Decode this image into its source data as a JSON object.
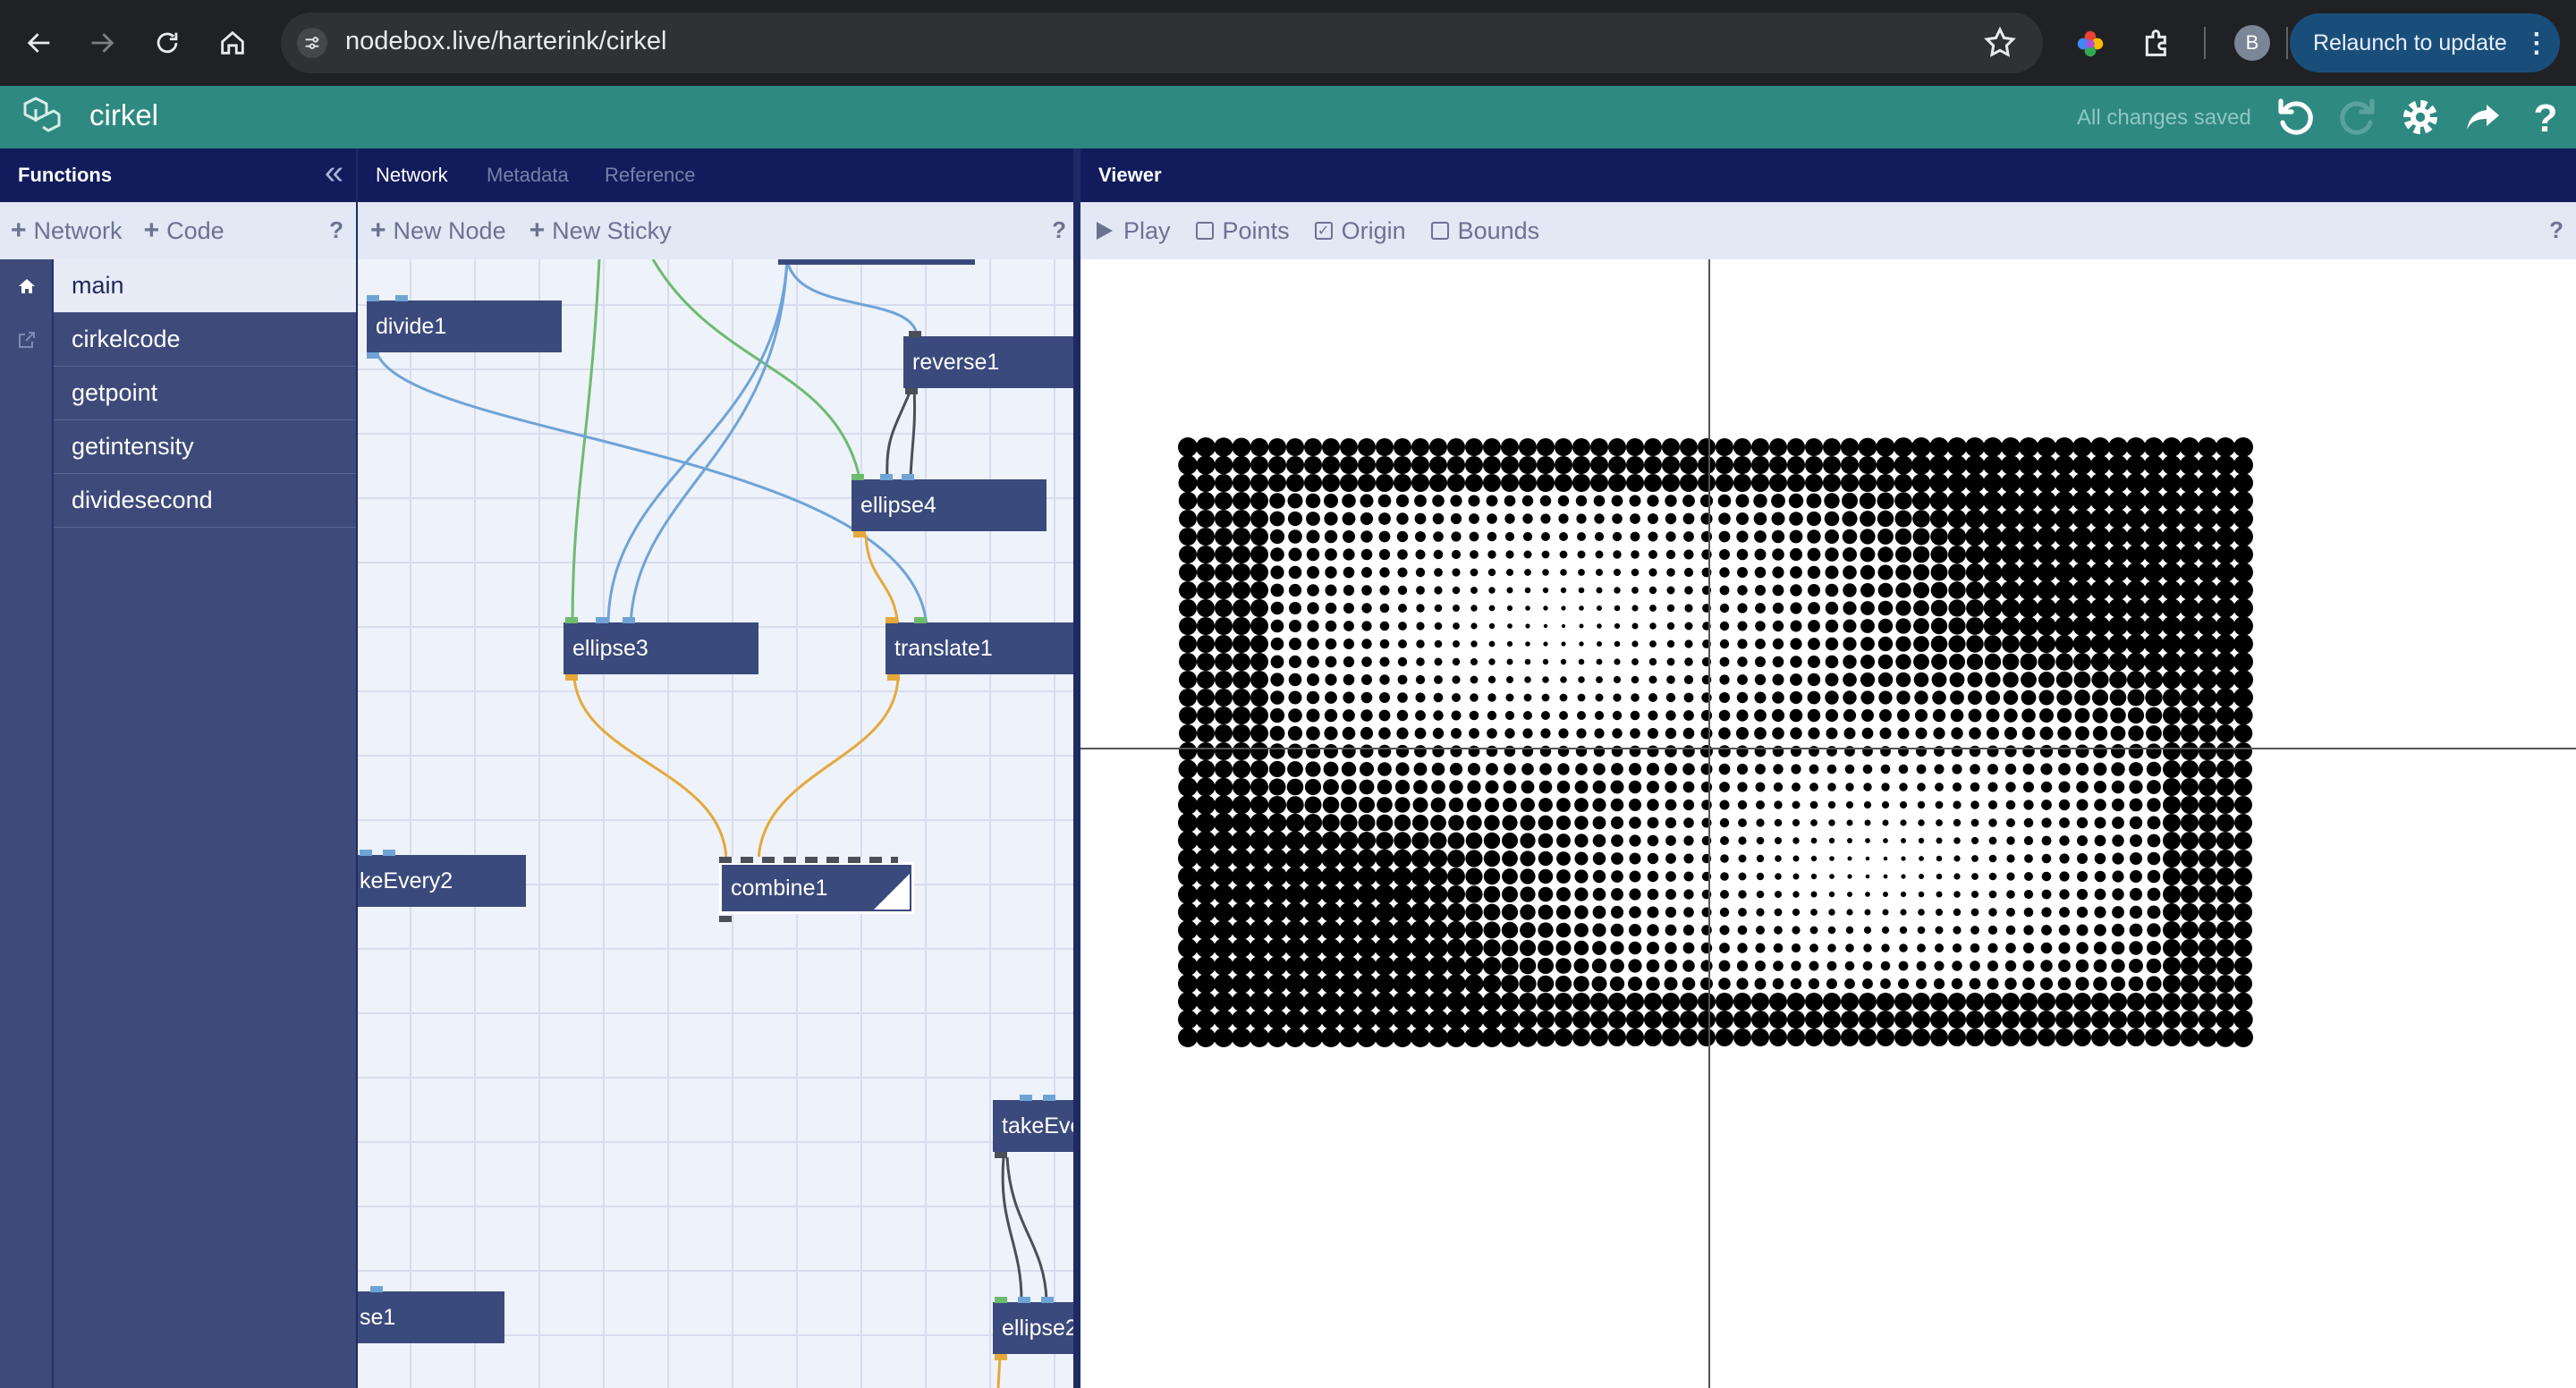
{
  "browser": {
    "url": "nodebox.live/harterink/cirkel",
    "avatar_letter": "B",
    "relaunch_label": "Relaunch to update",
    "relaunch_menu": "⋮"
  },
  "app": {
    "title": "cirkel",
    "save_status": "All changes saved",
    "header_color": "#2e8981"
  },
  "functions": {
    "title": "Functions",
    "collapse_glyph": "«",
    "toolbar": {
      "network_label": "Network",
      "code_label": "Code",
      "help": "?"
    },
    "items": [
      {
        "label": "main",
        "active": true
      },
      {
        "label": "cirkelcode"
      },
      {
        "label": "getpoint"
      },
      {
        "label": "getintensity"
      },
      {
        "label": "dividesecond"
      }
    ]
  },
  "network": {
    "tabs": [
      {
        "label": "Network",
        "active": true
      },
      {
        "label": "Metadata"
      },
      {
        "label": "Reference"
      }
    ],
    "toolbar": {
      "new_node_label": "New Node",
      "new_sticky_label": "New Sticky",
      "help": "?"
    },
    "nodes": {
      "divide1": "divide1",
      "reverse1": "reverse1",
      "ellipse4": "ellipse4",
      "ellipse3": "ellipse3",
      "translate1": "translate1",
      "takeEvery2": "keEvery2",
      "combine1": "combine1",
      "takeEvery_right": "takeEve",
      "reverse_left": "se1",
      "ellipse2": "ellipse2"
    }
  },
  "viewer": {
    "title": "Viewer",
    "play_label": "Play",
    "points_label": "Points",
    "points_checked": false,
    "origin_label": "Origin",
    "origin_checked": true,
    "bounds_label": "Bounds",
    "bounds_checked": false,
    "help": "?"
  },
  "colors": {
    "panel_header": "#121c5c",
    "node": "#3b4a7c",
    "wire_blue": "#6fa3d6",
    "wire_green": "#6dbb6d",
    "wire_orange": "#e5a93a",
    "wire_dark": "#4b4f5a"
  }
}
